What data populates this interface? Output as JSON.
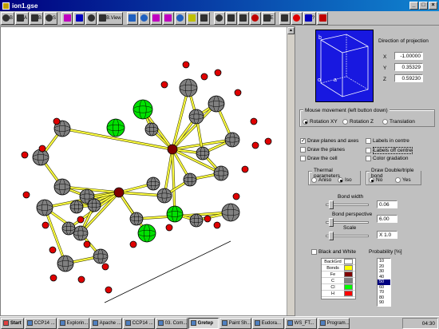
{
  "window": {
    "title": "ion1.gse"
  },
  "toolbar": {
    "buttons": [
      {
        "label": "B",
        "icon": "b-icon"
      },
      {
        "label": "A",
        "icon": "a-icon"
      },
      {
        "label": "B",
        "icon": "b2-icon"
      },
      {
        "label": "S",
        "icon": "s-icon"
      },
      {
        "label": "",
        "icon": "atom-down-icon"
      },
      {
        "label": "",
        "icon": "atom-up-icon"
      },
      {
        "label": "",
        "icon": "axes-icon"
      },
      {
        "label": "B.View",
        "icon": "bview-icon"
      },
      {
        "label": "",
        "icon": "rotate-icon"
      },
      {
        "label": "",
        "icon": "arrow-right-icon"
      },
      {
        "label": "",
        "icon": "arrow-double-icon"
      },
      {
        "label": "",
        "icon": "arrow-pink-icon"
      },
      {
        "label": "",
        "icon": "bond-icon"
      },
      {
        "label": "",
        "icon": "molecule-icon"
      },
      {
        "label": "",
        "icon": "move-icon"
      },
      {
        "label": "",
        "icon": "zoom-out-icon"
      },
      {
        "label": "",
        "icon": "zoom-in-icon"
      },
      {
        "label": "",
        "icon": "save-icon"
      },
      {
        "label": "",
        "icon": "palette-icon"
      },
      {
        "label": "E",
        "icon": "e-icon"
      },
      {
        "label": "",
        "icon": "target-icon"
      },
      {
        "label": "",
        "icon": "stop-icon"
      },
      {
        "label": "?",
        "icon": "help-icon"
      },
      {
        "label": "",
        "icon": "close-icon"
      }
    ]
  },
  "projection": {
    "title": "Direction of projection",
    "x_label": "X",
    "x_value": "-1.00000",
    "y_label": "Y",
    "y_value": "0.35329",
    "z_label": "Z",
    "z_value": "0.59230",
    "cell_labels": [
      "b",
      "a",
      "o"
    ]
  },
  "mouse": {
    "title": "Mouse movement (left button down)",
    "options": [
      "Rotation XY",
      "Rotation Z",
      "Translation"
    ],
    "selected": 0
  },
  "draw": {
    "planes_axes": "Draw planes and axes",
    "planes": "Draw the planes",
    "cell": "Draw the cell",
    "labels_centre": "Labels in centre",
    "labels_off_centre": "Labels off centre",
    "color_gradation": "Color gradation"
  },
  "thermal": {
    "title": "Thermal parameters",
    "aniso": "Aniso",
    "iso": "Iso"
  },
  "doubletriple": {
    "title": "Draw Double/triple bond",
    "no": "No",
    "yes": "Yes"
  },
  "sliders": {
    "bond_width_label": "Bond width",
    "bond_width_value": "0.06",
    "bond_persp_label": "Bond perspective",
    "bond_persp_value": "6.00",
    "scale_label": "Scale",
    "scale_value": "X 1.0"
  },
  "bw": {
    "label": "Black and White"
  },
  "legend": [
    {
      "name": "BackGrd",
      "color": "#ffffff"
    },
    {
      "name": "Bonds",
      "color": "#ffff00"
    },
    {
      "name": "Fe",
      "color": "#800000"
    },
    {
      "name": "C",
      "color": "#808080"
    },
    {
      "name": "Cl",
      "color": "#00ff00"
    },
    {
      "name": "H",
      "color": "#ff0000"
    }
  ],
  "probability": {
    "label": "Probability [%]",
    "options": [
      "10",
      "20",
      "30",
      "40",
      "50",
      "60",
      "70",
      "80",
      "90"
    ],
    "selected": "50"
  },
  "taskbar": {
    "start": "Start",
    "tasks": [
      "CCP14 ...",
      "Explorin...",
      "Apache ...",
      "CCP14 ...",
      "03. Com...",
      "Gretep",
      "Paint Sh...",
      "Eudora...",
      "WS_FT...",
      "Program..."
    ],
    "active": "Gretep",
    "time": "04:30"
  },
  "colors": {
    "atom_c": "#808080",
    "atom_fe": "#800000",
    "atom_cl": "#00e000",
    "atom_h": "#e00000",
    "bond": "#ffff40"
  }
}
